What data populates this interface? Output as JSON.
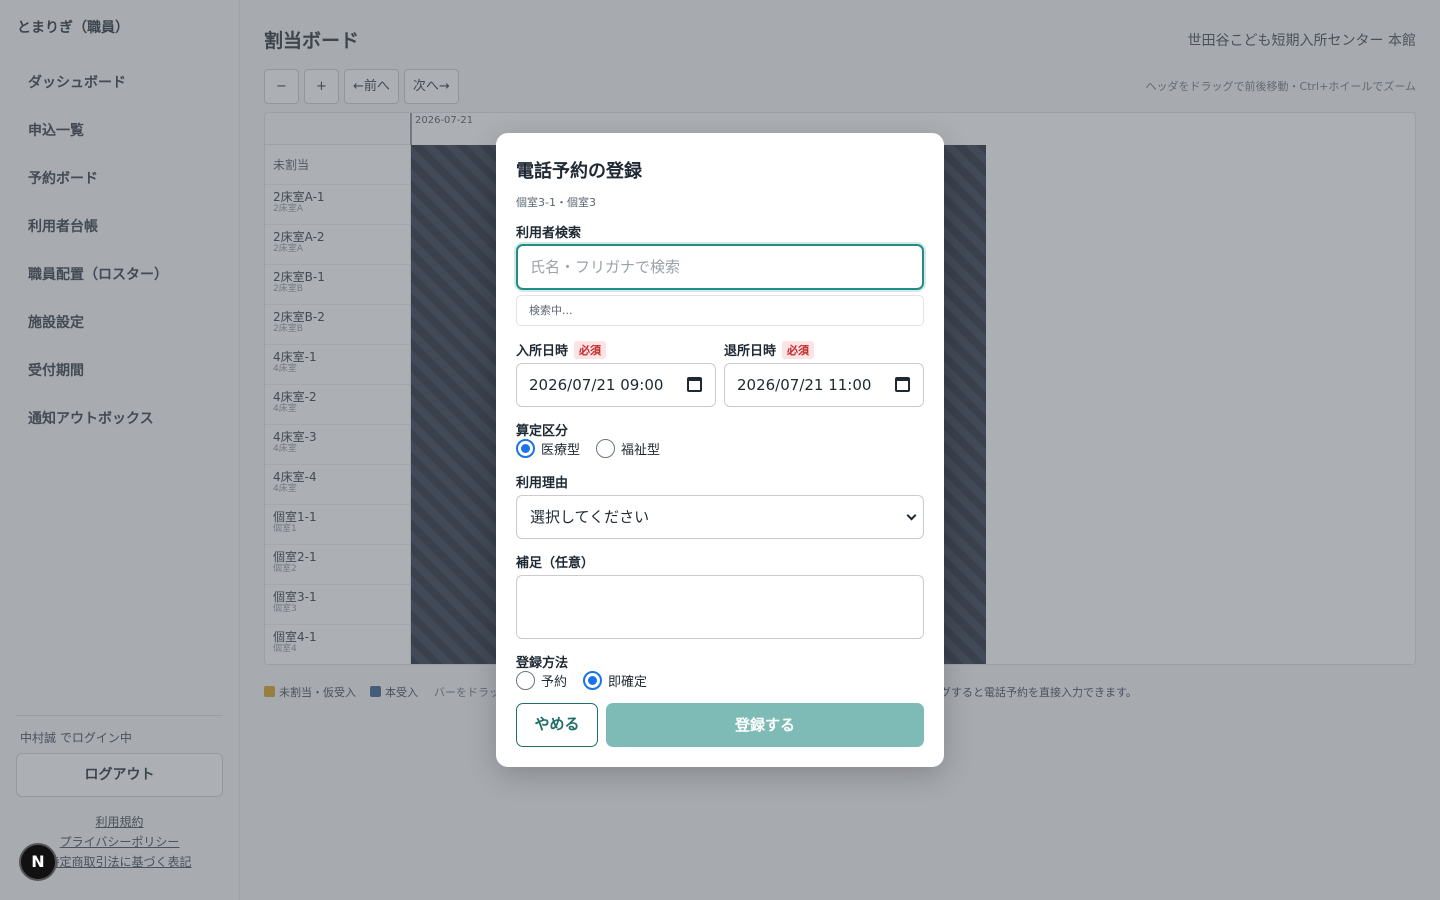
{
  "app": {
    "brand": "とまりぎ（職員）"
  },
  "sidebar": {
    "items": [
      {
        "label": "ダッシュボード"
      },
      {
        "label": "申込一覧"
      },
      {
        "label": "予約ボード"
      },
      {
        "label": "利用者台帳"
      },
      {
        "label": "職員配置（ロスター）"
      },
      {
        "label": "施設設定"
      },
      {
        "label": "受付期間"
      },
      {
        "label": "通知アウトボックス"
      }
    ],
    "login_status": "中村誠 でログイン中",
    "logout_label": "ログアウト",
    "links": [
      "利用規約",
      "プライバシーポリシー",
      "特定商取引法に基づく表記"
    ]
  },
  "badge": {
    "letter": "N"
  },
  "header": {
    "title": "割当ボード",
    "facility": "世田谷こども短期入所センター 本館"
  },
  "toolbar": {
    "zoom_out": "−",
    "zoom_in": "+",
    "prev": "←前へ",
    "next": "次へ→",
    "hint": "ヘッダをドラッグで前後移動・Ctrl+ホイールでズーム"
  },
  "board": {
    "date": "2026-07-21",
    "unassigned_label": "未割当",
    "rows": [
      {
        "name": "2床室A-1",
        "room": "2床室A"
      },
      {
        "name": "2床室A-2",
        "room": "2床室A"
      },
      {
        "name": "2床室B-1",
        "room": "2床室B"
      },
      {
        "name": "2床室B-2",
        "room": "2床室B"
      },
      {
        "name": "4床室-1",
        "room": "4床室"
      },
      {
        "name": "4床室-2",
        "room": "4床室"
      },
      {
        "name": "4床室-3",
        "room": "4床室"
      },
      {
        "name": "4床室-4",
        "room": "4床室"
      },
      {
        "name": "個室1-1",
        "room": "個室1"
      },
      {
        "name": "個室2-1",
        "room": "個室2"
      },
      {
        "name": "個室3-1",
        "room": "個室3"
      },
      {
        "name": "個室4-1",
        "room": "個室4"
      }
    ]
  },
  "legend": {
    "tentative": "未割当・仮受入",
    "accepted": "本受入",
    "note": "バーをドラッ",
    "note_right": "グすると電話予約を直接入力できます。",
    "colors": {
      "tentative": "#d4a017",
      "accepted": "#2f5a8a"
    }
  },
  "modal": {
    "title": "電話予約の登録",
    "subtitle": "個室3-1・個室3",
    "user_search_label": "利用者検索",
    "search_placeholder": "氏名・フリガナで検索",
    "searching": "検索中...",
    "checkin_label": "入所日時",
    "checkout_label": "退所日時",
    "required": "必須",
    "checkin_value": "2026/07/21 09:00",
    "checkout_value": "2026/07/21 11:00",
    "category_label": "算定区分",
    "category_options": [
      "医療型",
      "福祉型"
    ],
    "category_selected": "医療型",
    "reason_label": "利用理由",
    "reason_value": "選択してください",
    "note_label": "補足（任意）",
    "method_label": "登録方法",
    "method_options": [
      "予約",
      "即確定"
    ],
    "method_selected": "即確定",
    "cancel": "やめる",
    "submit": "登録する",
    "accent_color": "#1f8f86"
  }
}
